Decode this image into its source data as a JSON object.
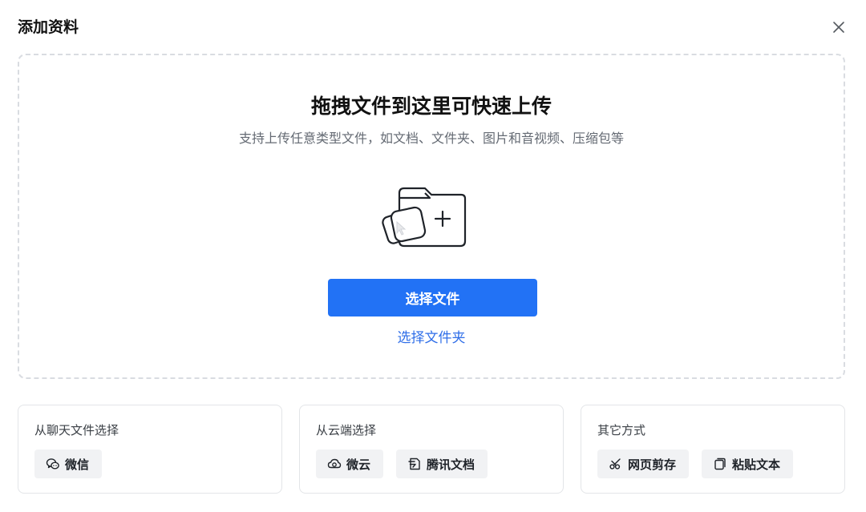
{
  "dialog": {
    "title": "添加资料",
    "close_icon": "close-icon"
  },
  "dropzone": {
    "title": "拖拽文件到这里可快速上传",
    "subtitle": "支持上传任意类型文件，如文档、文件夹、图片和音视频、压缩包等",
    "illustration": "folder-upload-icon",
    "primary_button": "选择文件",
    "folder_link": "选择文件夹"
  },
  "sources": [
    {
      "title": "从聊天文件选择",
      "options": [
        {
          "label": "微信",
          "icon": "wechat-icon"
        }
      ]
    },
    {
      "title": "从云端选择",
      "options": [
        {
          "label": "微云",
          "icon": "cloud-icon"
        },
        {
          "label": "腾讯文档",
          "icon": "tencent-docs-icon"
        }
      ]
    },
    {
      "title": "其它方式",
      "options": [
        {
          "label": "网页剪存",
          "icon": "scissors-icon"
        },
        {
          "label": "粘贴文本",
          "icon": "paste-icon"
        }
      ]
    }
  ],
  "colors": {
    "primary": "#2272f5",
    "link": "#2f6ee8",
    "chip_bg": "#f1f2f4",
    "border": "#d9dce1"
  }
}
